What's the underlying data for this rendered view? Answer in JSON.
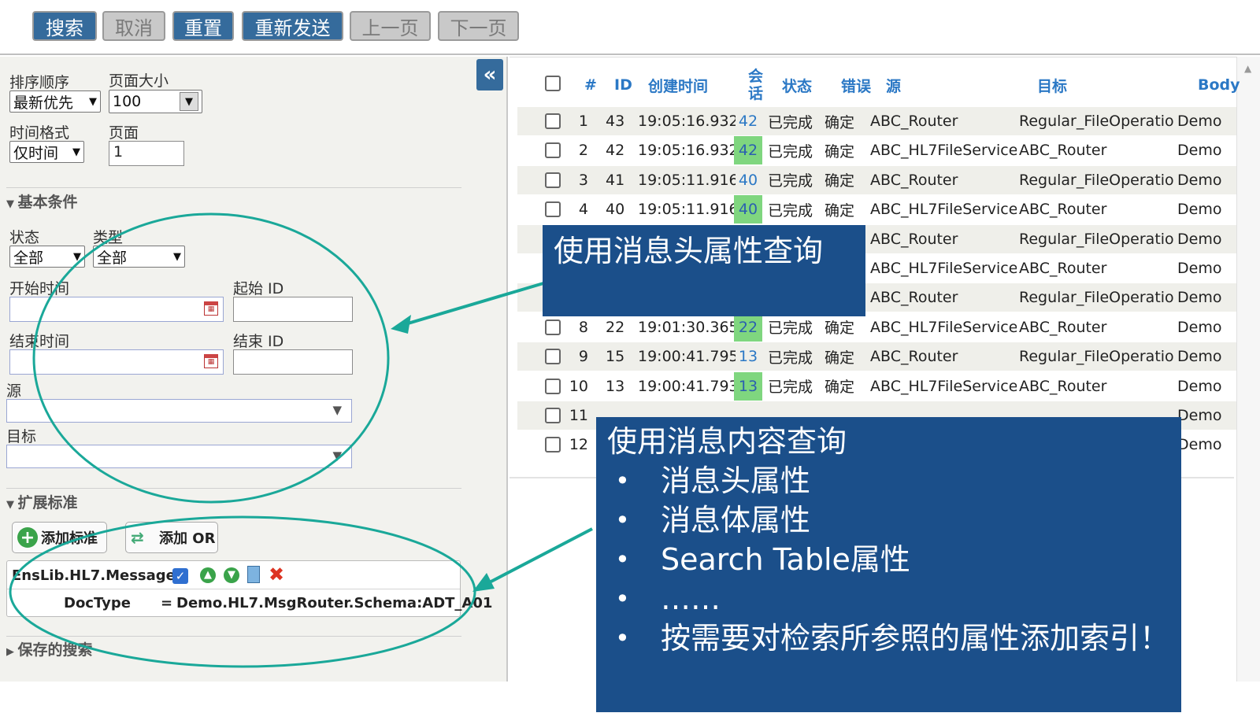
{
  "toolbar": {
    "search": "搜索",
    "cancel": "取消",
    "reset": "重置",
    "resend": "重新发送",
    "prev": "上一页",
    "next": "下一页"
  },
  "left": {
    "sort_label": "排序顺序",
    "sort_value": "最新优先",
    "page_size_label": "页面大小",
    "page_size_value": "100",
    "time_format_label": "时间格式",
    "time_format_value": "仅时间",
    "page_label": "页面",
    "page_value": "1",
    "basic_section": "基本条件",
    "status_label": "状态",
    "status_value": "全部",
    "type_label": "类型",
    "type_value": "全部",
    "start_time_label": "开始时间",
    "start_id_label": "起始 ID",
    "end_time_label": "结束时间",
    "end_id_label": "结束 ID",
    "source_label": "源",
    "target_label": "目标",
    "extended_section": "扩展标准",
    "add_criteria": "添加标准",
    "add_or": "添加 OR",
    "criteria_class": "EnsLib.HL7.Message",
    "criteria_field": "DocType",
    "criteria_op": "=",
    "criteria_value": "Demo.HL7.MsgRouter.Schema:ADT_A01",
    "saved_section": "保存的搜索"
  },
  "table": {
    "headers": {
      "num": "#",
      "id": "ID",
      "created": "创建时间",
      "session": "会\n话",
      "status": "状态",
      "error": "错误",
      "source": "源",
      "target": "目标",
      "body": "Body"
    },
    "rows": [
      {
        "num": "1",
        "id": "43",
        "time": "19:05:16.932",
        "session": "42",
        "status": "已完成",
        "error": "确定",
        "source": "ABC_Router",
        "target": "Regular_FileOperation",
        "body": "Demo"
      },
      {
        "num": "2",
        "id": "42",
        "time": "19:05:16.932",
        "session": "42",
        "status": "已完成",
        "error": "确定",
        "source": "ABC_HL7FileService",
        "target": "ABC_Router",
        "body": "Demo"
      },
      {
        "num": "3",
        "id": "41",
        "time": "19:05:11.916",
        "session": "40",
        "status": "已完成",
        "error": "确定",
        "source": "ABC_Router",
        "target": "Regular_FileOperation",
        "body": "Demo"
      },
      {
        "num": "4",
        "id": "40",
        "time": "19:05:11.916",
        "session": "40",
        "status": "已完成",
        "error": "确定",
        "source": "ABC_HL7FileService",
        "target": "ABC_Router",
        "body": "Demo"
      },
      {
        "num": "",
        "id": "",
        "time": "",
        "session": "",
        "status": "",
        "error": "定",
        "source": "ABC_Router",
        "target": "Regular_FileOperation",
        "body": "Demo"
      },
      {
        "num": "",
        "id": "",
        "time": "",
        "session": "",
        "status": "",
        "error": "定",
        "source": "ABC_HL7FileService",
        "target": "ABC_Router",
        "body": "Demo"
      },
      {
        "num": "",
        "id": "",
        "time": "",
        "session": "",
        "status": "",
        "error": "定",
        "source": "ABC_Router",
        "target": "Regular_FileOperation",
        "body": "Demo"
      },
      {
        "num": "8",
        "id": "22",
        "time": "19:01:30.365",
        "session": "22",
        "status": "已完成",
        "error": "确定",
        "source": "ABC_HL7FileService",
        "target": "ABC_Router",
        "body": "Demo"
      },
      {
        "num": "9",
        "id": "15",
        "time": "19:00:41.795",
        "session": "13",
        "status": "已完成",
        "error": "确定",
        "source": "ABC_Router",
        "target": "Regular_FileOperation",
        "body": "Demo"
      },
      {
        "num": "10",
        "id": "13",
        "time": "19:00:41.793",
        "session": "13",
        "status": "已完成",
        "error": "确定",
        "source": "ABC_HL7FileService",
        "target": "ABC_Router",
        "body": "Demo"
      },
      {
        "num": "11",
        "id": "",
        "time": "",
        "session": "",
        "status": "",
        "error": "",
        "source": "",
        "target": "",
        "body": "Demo"
      },
      {
        "num": "12",
        "id": "",
        "time": "",
        "session": "",
        "status": "",
        "error": "",
        "source": "",
        "target": "",
        "body": "Demo"
      }
    ]
  },
  "callouts": {
    "header_query": "使用消息头属性查询",
    "content_query_title": "使用消息内容查询",
    "bullets": [
      "消息头属性",
      "消息体属性",
      "Search Table属性",
      "……",
      "按需要对检索所参照的属性添加索引！"
    ]
  },
  "colors": {
    "accent_blue": "#356b9c",
    "callout_blue": "#1b4f8a",
    "annotation_teal": "#1aa899",
    "session_green": "#7fd67f"
  }
}
